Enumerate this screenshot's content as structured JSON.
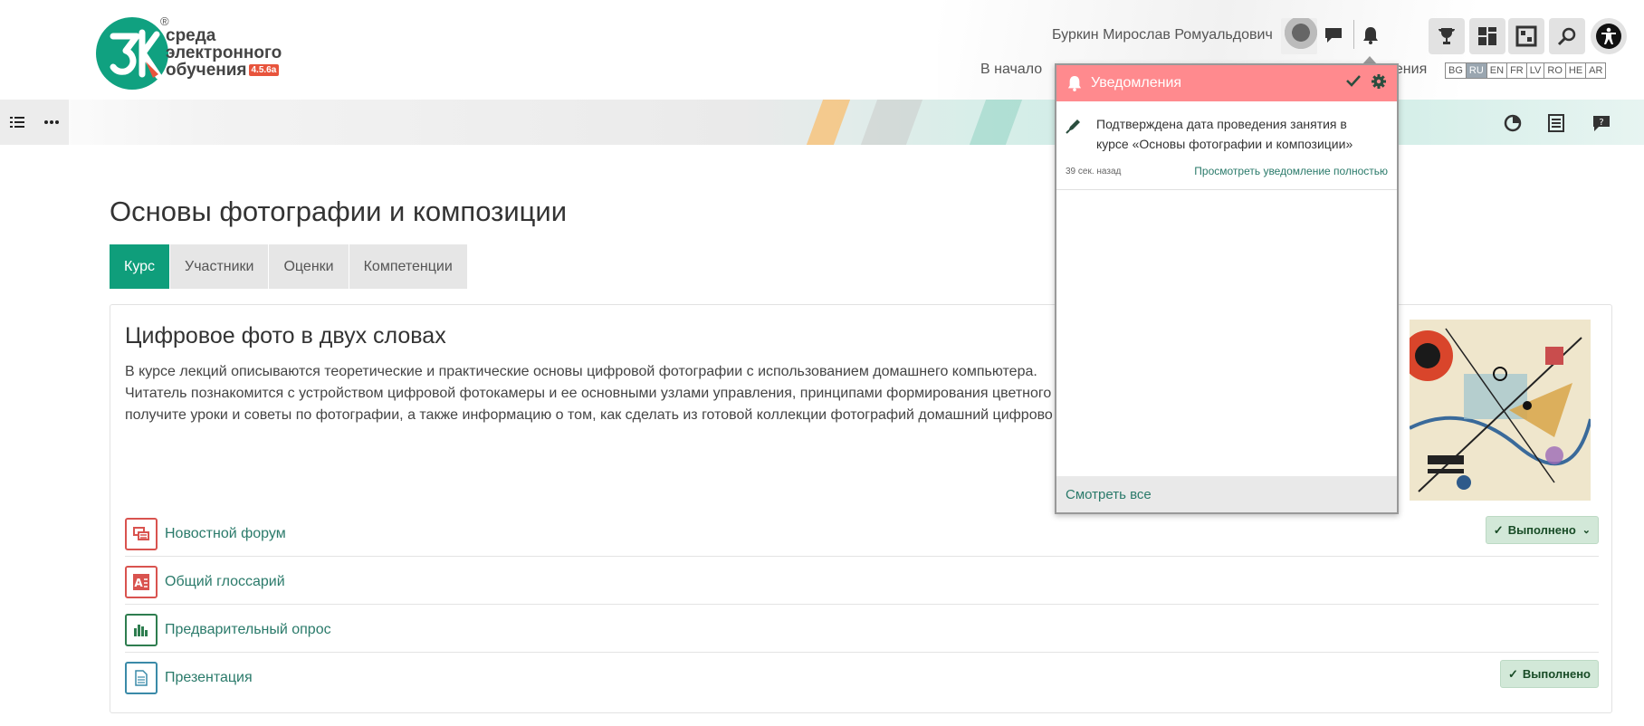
{
  "brand": {
    "logo_letters": "ЗК",
    "reg_mark": "®",
    "line1": "среда",
    "line2": "электронного",
    "line3": "обучения",
    "version": "4.5.6a",
    "teal": "#10a180",
    "orange": "#e8543c"
  },
  "user": {
    "name": "Буркин Мирослав Ромуальдович"
  },
  "header_icons": [
    "chat-icon",
    "bell-icon"
  ],
  "tool_icons": [
    "trophy-icon",
    "dashboard-icon",
    "grid-icon",
    "search-icon",
    "accessibility-icon"
  ],
  "nav": {
    "home": "В начало",
    "tail": "рения"
  },
  "languages": [
    {
      "code": "BG",
      "active": false
    },
    {
      "code": "RU",
      "active": true
    },
    {
      "code": "EN",
      "active": false
    },
    {
      "code": "FR",
      "active": false
    },
    {
      "code": "LV",
      "active": false
    },
    {
      "code": "RO",
      "active": false
    },
    {
      "code": "HE",
      "active": false
    },
    {
      "code": "AR",
      "active": false
    }
  ],
  "course": {
    "title": "Основы фотографии и композиции",
    "tabs": [
      {
        "label": "Курс",
        "active": true
      },
      {
        "label": "Участники",
        "active": false
      },
      {
        "label": "Оценки",
        "active": false
      },
      {
        "label": "Компетенции",
        "active": false
      }
    ],
    "section_title": "Цифровое фото в двух словах",
    "summary_lines": [
      "В курсе лекций описываются теоретические и практические основы цифровой фотографии с использованием домашнего компьютера.",
      "Читатель познакомится с устройством цифровой фотокамеры и ее основными узлами управления, принципами формирования цветного",
      "получите уроки и советы по фотографии, а также информацию о том, как сделать из готовой коллекции фотографий домашний цифрово"
    ],
    "activities": [
      {
        "name": "Новостной форум",
        "icon": "forum-icon",
        "color": "#d9534f",
        "done": "Выполнено",
        "dropdown": true
      },
      {
        "name": "Общий глоссарий",
        "icon": "glossary-icon",
        "color": "#d9534f",
        "done": "",
        "dropdown": false
      },
      {
        "name": "Предварительный опрос",
        "icon": "survey-icon",
        "color": "#2e7d4f",
        "done": "",
        "dropdown": false
      },
      {
        "name": "Презентация",
        "icon": "file-icon",
        "color": "#3a8aa8",
        "done": "Выполнено",
        "dropdown": false
      }
    ]
  },
  "notifications": {
    "header": "Уведомления",
    "header_color": "#ff8a8e",
    "items": [
      {
        "message": "Подтверждена дата проведения занятия в курсе «Основы фотографии и композиции»",
        "time": "39 сек. назад",
        "link": "Просмотреть уведомление полностью"
      }
    ],
    "footer": "Смотреть все"
  }
}
